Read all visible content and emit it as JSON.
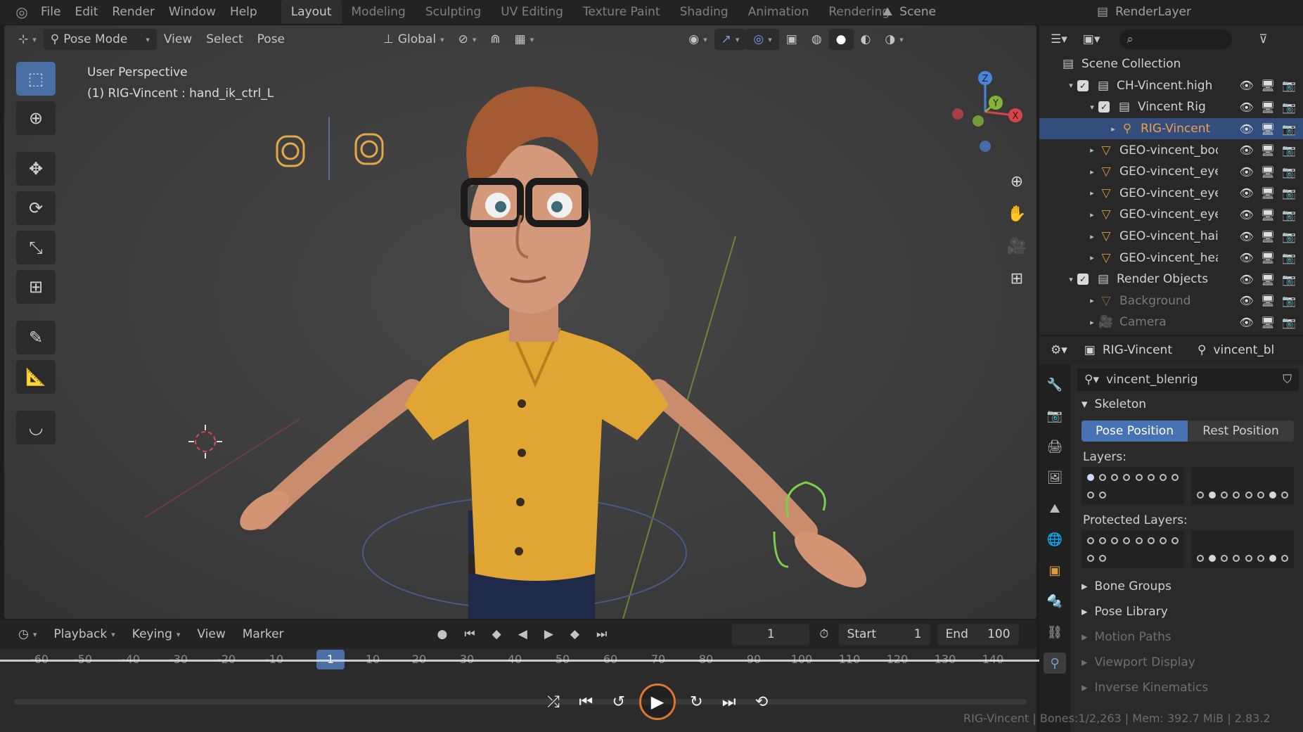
{
  "menubar": {
    "menus": [
      "File",
      "Edit",
      "Render",
      "Window",
      "Help"
    ],
    "workspaces": [
      "Layout",
      "Modeling",
      "Sculpting",
      "UV Editing",
      "Texture Paint",
      "Shading",
      "Animation",
      "Rendering"
    ],
    "active_workspace": "Layout",
    "scene": "Scene",
    "render_layer": "RenderLayer"
  },
  "viewport": {
    "mode": "Pose Mode",
    "menus": [
      "View",
      "Select",
      "Pose"
    ],
    "transform_orientation": "Global",
    "info_line1": "User Perspective",
    "info_line2": "(1) RIG-Vincent : hand_ik_ctrl_L",
    "gizmo_axes": {
      "x": "X",
      "y": "Y",
      "z": "Z"
    }
  },
  "tools": [
    "select-box",
    "cursor",
    "move",
    "rotate",
    "scale",
    "transform",
    "annotate",
    "measure",
    "bend"
  ],
  "timeline": {
    "menus": [
      "Playback",
      "Keying",
      "View",
      "Marker"
    ],
    "current_frame": "1",
    "start_label": "Start",
    "start_value": "1",
    "end_label": "End",
    "end_value": "100",
    "ruler": [
      "-60",
      "-50",
      "-40",
      "-30",
      "-20",
      "-10",
      "1",
      "10",
      "20",
      "30",
      "40",
      "50",
      "60",
      "70",
      "80",
      "90",
      "100",
      "110",
      "120",
      "130",
      "140"
    ]
  },
  "outliner": {
    "rows": [
      {
        "label": "Scene Collection"
      },
      {
        "label": "CH-Vincent.high"
      },
      {
        "label": "Vincent Rig"
      },
      {
        "label": "RIG-Vincent"
      },
      {
        "label": "GEO-vincent_bod"
      },
      {
        "label": "GEO-vincent_eyel"
      },
      {
        "label": "GEO-vincent_eyel"
      },
      {
        "label": "GEO-vincent_eye"
      },
      {
        "label": "GEO-vincent_hair"
      },
      {
        "label": "GEO-vincent_hea"
      },
      {
        "label": "Render Objects"
      },
      {
        "label": "Background"
      },
      {
        "label": "Camera"
      }
    ]
  },
  "properties": {
    "object": "RIG-Vincent",
    "armature_short": "vincent_bl",
    "armature": "vincent_blenrig",
    "skeleton_title": "Skeleton",
    "pose_position": "Pose Position",
    "rest_position": "Rest Position",
    "layers_label": "Layers:",
    "protected_label": "Protected Layers:",
    "panels": [
      "Bone Groups",
      "Pose Library",
      "Motion Paths",
      "Viewport Display",
      "Inverse Kinematics"
    ]
  },
  "status": "RIG-Vincent | Bones:1/2,263 | Mem: 392.7 MiB | 2.83.2",
  "colors": {
    "accent": "#4772b3",
    "selected_row": "#334d7c",
    "play_ring": "#e0762e"
  }
}
